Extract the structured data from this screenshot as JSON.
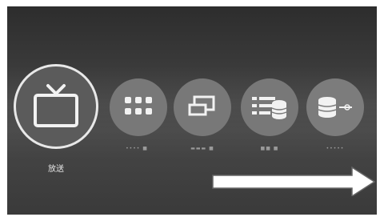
{
  "app_bar": {
    "items": [
      {
        "label": "放送",
        "icon": "tv-icon",
        "selected": true
      },
      {
        "label": "•••• ■",
        "icon": "apps-grid-icon",
        "selected": false
      },
      {
        "label": "▬▬▬ ■",
        "icon": "monitor-icon",
        "selected": false
      },
      {
        "label": "■■ ■",
        "icon": "media-list-icon",
        "selected": false
      },
      {
        "label": "•••••",
        "icon": "device-link-icon",
        "selected": false
      }
    ]
  },
  "scroll_hint": {
    "icon": "right-arrow-icon"
  },
  "colors": {
    "background": "#3a3a3a",
    "tile_fill": "#7a7a7a",
    "selected_ring": "#e8e8e8",
    "icon": "#f2f2f2"
  }
}
